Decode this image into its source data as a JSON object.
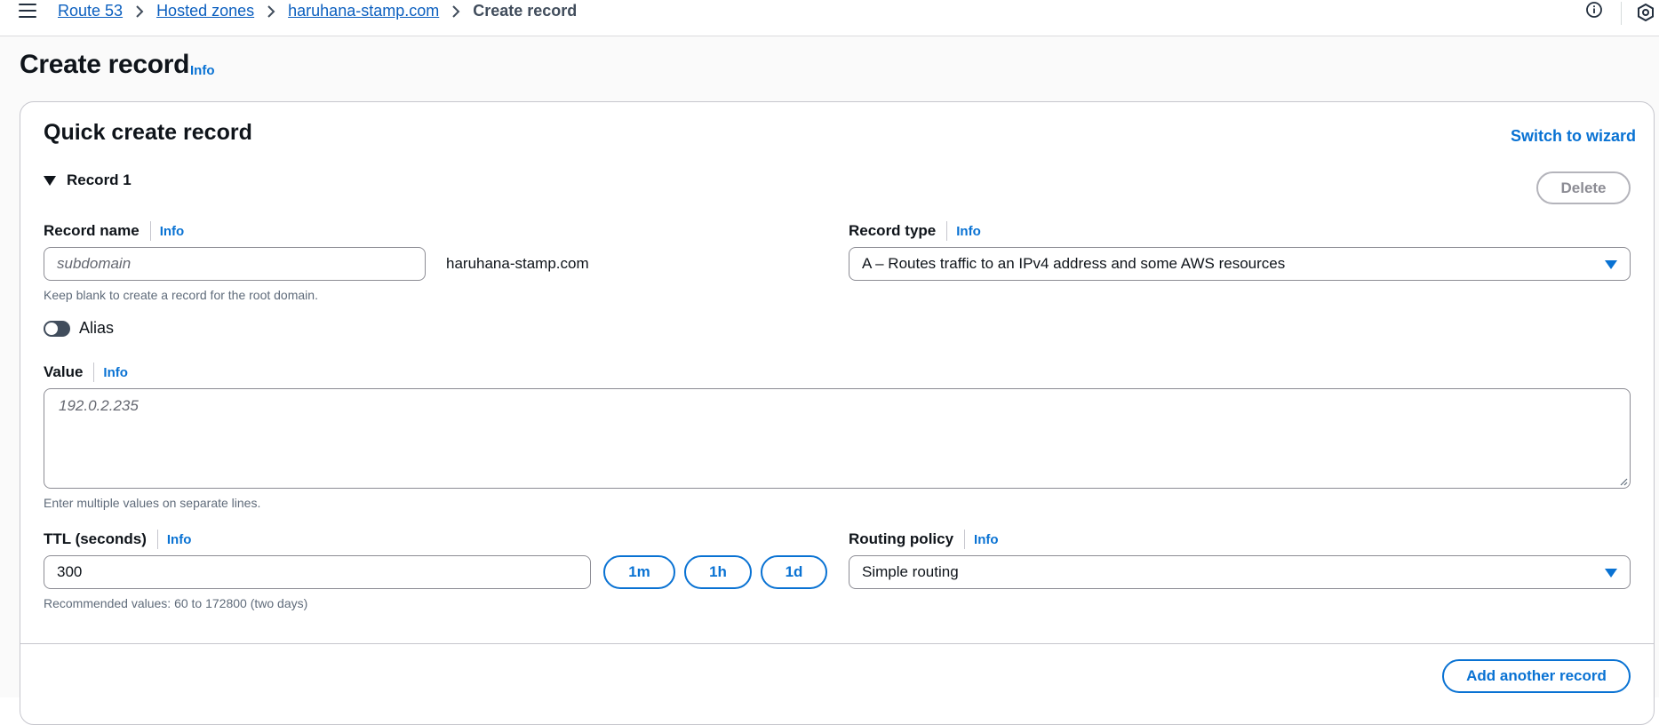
{
  "breadcrumb": {
    "items": [
      {
        "label": "Route 53"
      },
      {
        "label": "Hosted zones"
      },
      {
        "label": "haruhana-stamp.com"
      },
      {
        "label": "Create record"
      }
    ]
  },
  "page": {
    "title": "Create record",
    "info_label": "Info"
  },
  "card": {
    "title": "Quick create record",
    "switch_label": "Switch to wizard"
  },
  "record": {
    "section_label": "Record 1",
    "delete_label": "Delete",
    "name": {
      "label": "Record name",
      "info": "Info",
      "placeholder": "subdomain",
      "value": "",
      "suffix": "haruhana-stamp.com",
      "help": "Keep blank to create a record for the root domain."
    },
    "type": {
      "label": "Record type",
      "info": "Info",
      "selected": "A – Routes traffic to an IPv4 address and some AWS resources"
    },
    "alias": {
      "label": "Alias",
      "enabled": false
    },
    "value": {
      "label": "Value",
      "info": "Info",
      "placeholder": "192.0.2.235",
      "help": "Enter multiple values on separate lines."
    },
    "ttl": {
      "label": "TTL (seconds)",
      "info": "Info",
      "value": "300",
      "help": "Recommended values: 60 to 172800 (two days)",
      "presets": [
        "1m",
        "1h",
        "1d"
      ]
    },
    "routing": {
      "label": "Routing policy",
      "info": "Info",
      "selected": "Simple routing"
    }
  },
  "footer": {
    "add_label": "Add another record"
  },
  "colors": {
    "link": "#0b5fbf",
    "accent": "#0972d3",
    "toggle_off": "#414d5c",
    "disabled": "#8c8c94"
  }
}
